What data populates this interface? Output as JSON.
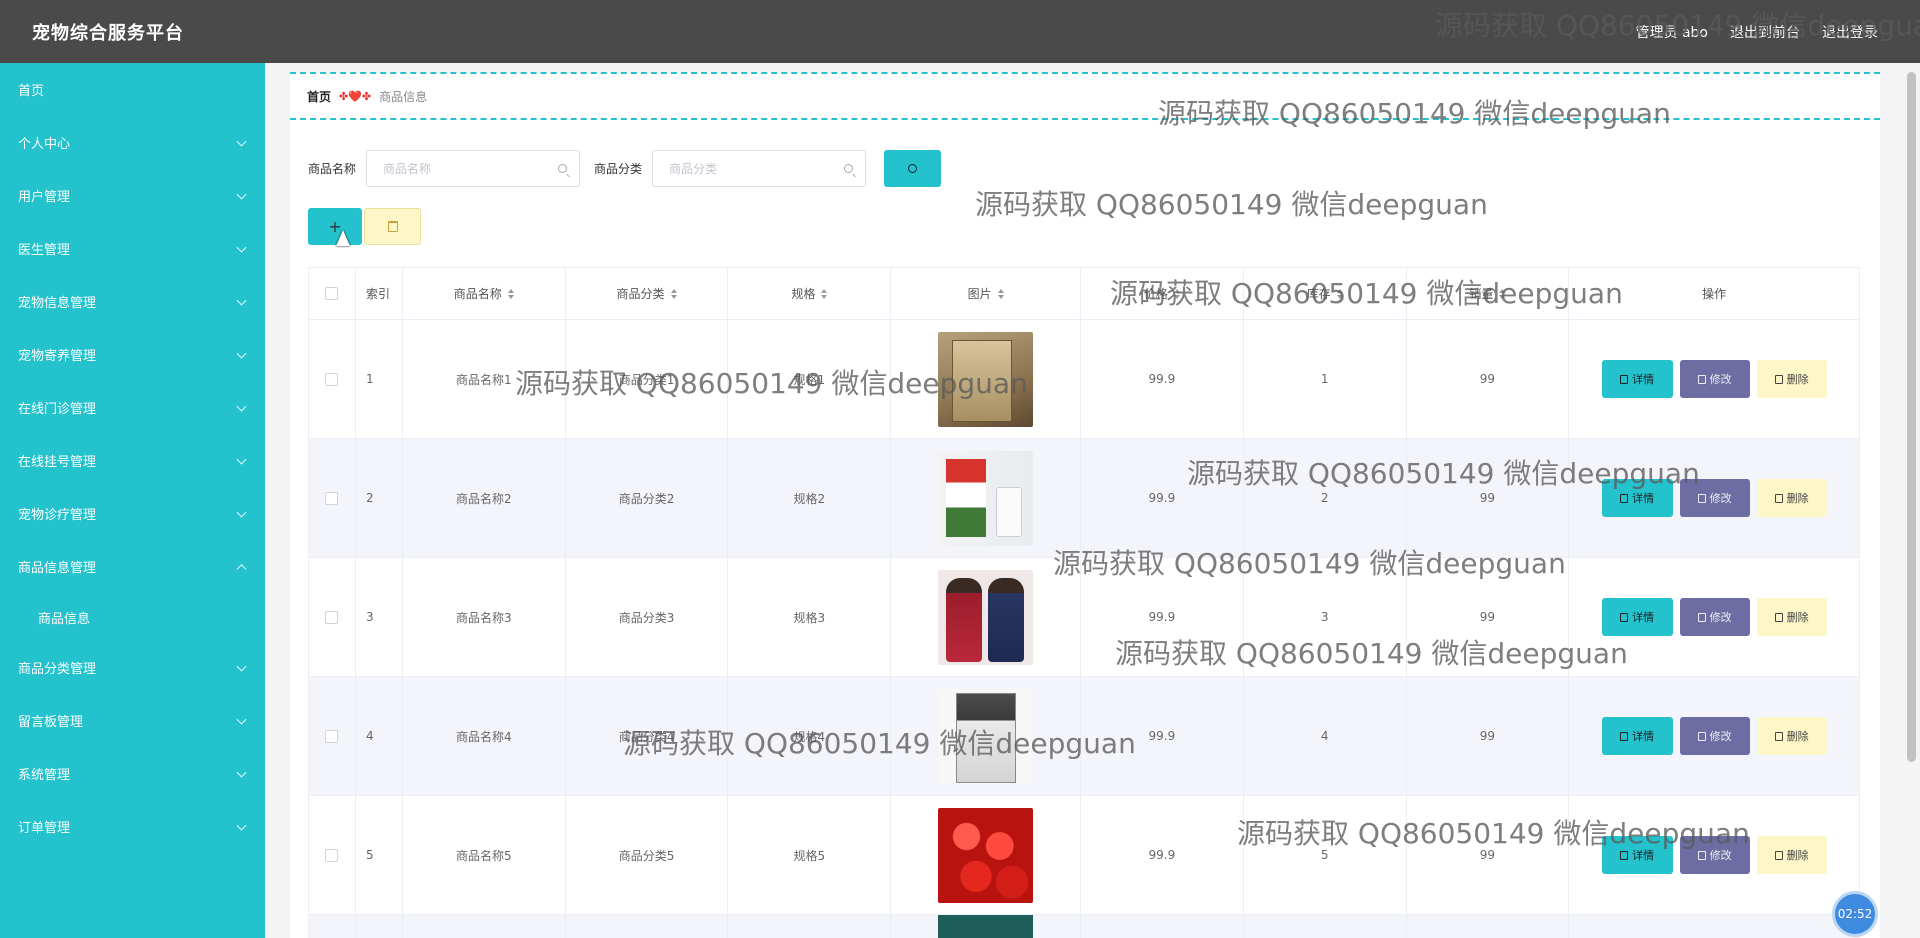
{
  "header": {
    "brand": "宠物综合服务平台",
    "user": "管理员 abo",
    "back_to_front": "退出到前台",
    "logout": "退出登录"
  },
  "sidebar": {
    "items": [
      {
        "label": "首页",
        "has_children": false
      },
      {
        "label": "个人中心",
        "has_children": true
      },
      {
        "label": "用户管理",
        "has_children": true
      },
      {
        "label": "医生管理",
        "has_children": true
      },
      {
        "label": "宠物信息管理",
        "has_children": true
      },
      {
        "label": "宠物寄养管理",
        "has_children": true
      },
      {
        "label": "在线门诊管理",
        "has_children": true
      },
      {
        "label": "在线挂号管理",
        "has_children": true
      },
      {
        "label": "宠物诊疗管理",
        "has_children": true
      },
      {
        "label": "商品信息管理",
        "has_children": true,
        "open": true
      },
      {
        "label": "商品分类管理",
        "has_children": true
      },
      {
        "label": "留言板管理",
        "has_children": true
      },
      {
        "label": "系统管理",
        "has_children": true
      },
      {
        "label": "订单管理",
        "has_children": true
      }
    ],
    "sub_item": "商品信息"
  },
  "breadcrumb": {
    "home": "首页",
    "separator": "✤❤️✤",
    "current": "商品信息"
  },
  "search": {
    "name_label": "商品名称",
    "name_placeholder": "商品名称",
    "category_label": "商品分类",
    "category_placeholder": "商品分类"
  },
  "actions": {
    "add": "+"
  },
  "table": {
    "columns": [
      "索引",
      "商品名称",
      "商品分类",
      "规格",
      "图片",
      "价格",
      "库存",
      "销量",
      "操作"
    ],
    "rows": [
      {
        "index": "1",
        "name": "商品名称1",
        "category": "商品分类1",
        "spec": "规格1",
        "image": "book-cover",
        "price": "99.9",
        "stock": "1",
        "sales": "99"
      },
      {
        "index": "2",
        "name": "商品名称2",
        "category": "商品分类2",
        "spec": "规格2",
        "image": "milk-carton",
        "price": "99.9",
        "stock": "2",
        "sales": "99"
      },
      {
        "index": "3",
        "name": "商品名称3",
        "category": "商品分类3",
        "spec": "规格3",
        "image": "dresses",
        "price": "99.9",
        "stock": "3",
        "sales": "99"
      },
      {
        "index": "4",
        "name": "商品名称4",
        "category": "商品分类4",
        "spec": "规格4",
        "image": "book-cover-2",
        "price": "99.9",
        "stock": "4",
        "sales": "99"
      },
      {
        "index": "5",
        "name": "商品名称5",
        "category": "商品分类5",
        "spec": "规格5",
        "image": "cherries",
        "price": "99.9",
        "stock": "5",
        "sales": "99"
      }
    ],
    "op_detail": "详情",
    "op_edit": "修改",
    "op_delete": "删除"
  },
  "watermark": "源码获取 QQ86050149 微信deepguan",
  "clock": "02:52",
  "colors": {
    "accent": "#23c2cc",
    "header": "#4a4a4a",
    "edit": "#6d6da3",
    "delete": "#fdf7c8"
  }
}
